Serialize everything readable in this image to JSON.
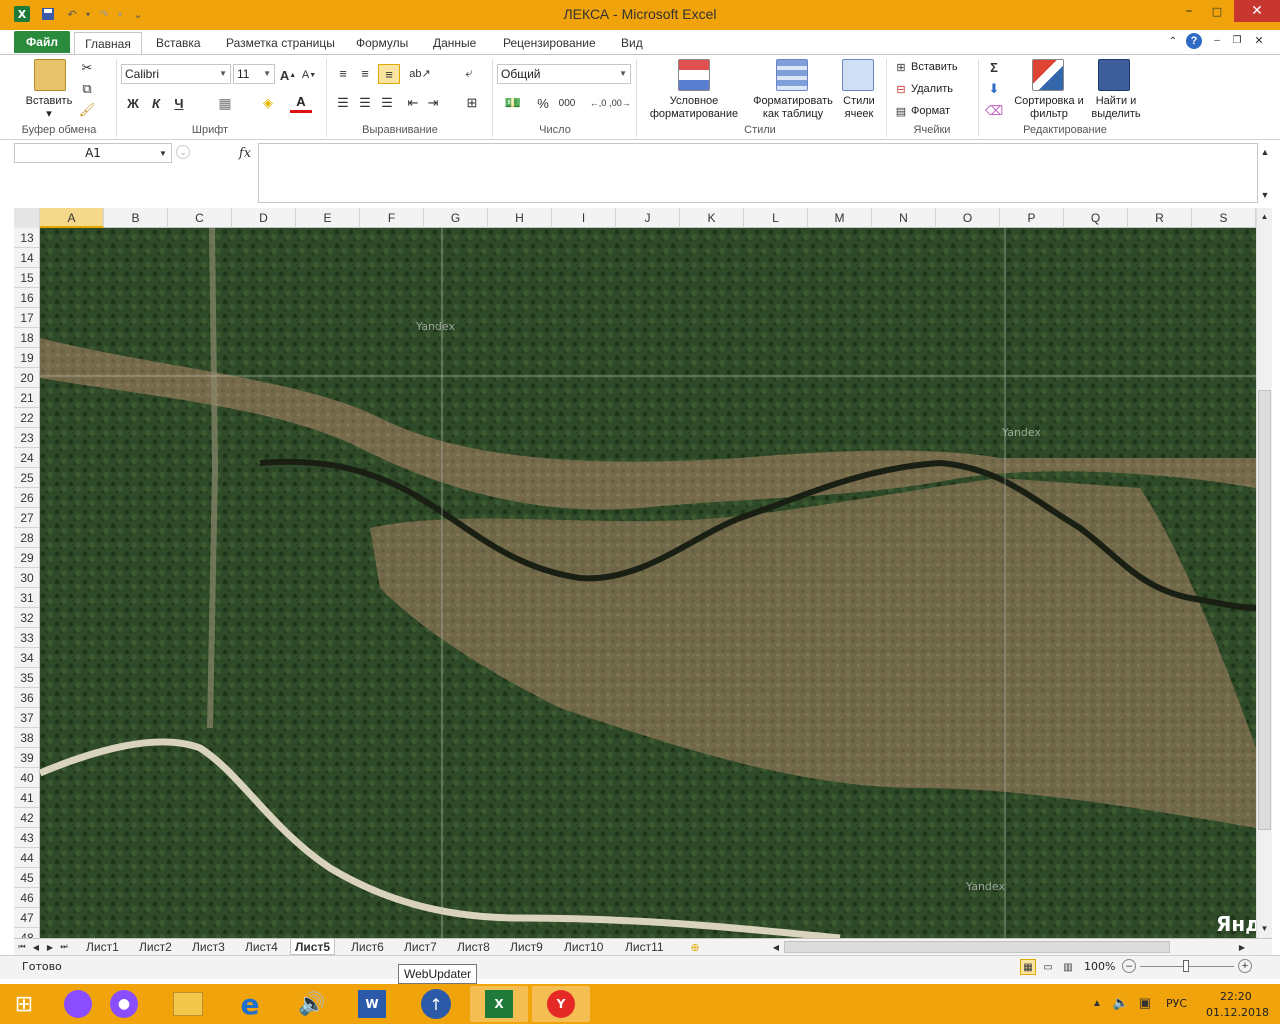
{
  "window": {
    "title": "ЛЕКСА  -  Microsoft Excel"
  },
  "ribbon_tabs": [
    "Файл",
    "Главная",
    "Вставка",
    "Разметка страницы",
    "Формулы",
    "Данные",
    "Рецензирование",
    "Вид"
  ],
  "ribbon": {
    "paste_label": "Вставить",
    "font_name": "Calibri",
    "font_size": "11",
    "bold": "Ж",
    "italic": "К",
    "underline": "Ч",
    "number_format": "Общий",
    "percent": "%",
    "thousands": "000",
    "cond_format": "Условное форматирование",
    "format_table": "Форматировать как таблицу",
    "cell_styles": "Стили ячеек",
    "insert": "Вставить",
    "delete": "Удалить",
    "format": "Формат",
    "sort_filter": "Сортировка и фильтр",
    "find_select": "Найти и выделить",
    "groups": {
      "clipboard": "Буфер обмена",
      "font": "Шрифт",
      "alignment": "Выравнивание",
      "number": "Число",
      "styles": "Стили",
      "cells": "Ячейки",
      "editing": "Редактирование"
    }
  },
  "formula_bar": {
    "name_box": "A1",
    "fx": "fx",
    "content": ""
  },
  "columns": [
    "A",
    "B",
    "C",
    "D",
    "E",
    "F",
    "G",
    "H",
    "I",
    "J",
    "K",
    "L",
    "M",
    "N",
    "O",
    "P",
    "Q",
    "R",
    "S"
  ],
  "rows": [
    "13",
    "14",
    "15",
    "16",
    "17",
    "18",
    "19",
    "20",
    "21",
    "22",
    "23",
    "24",
    "25",
    "26",
    "27",
    "28",
    "29",
    "30",
    "31",
    "32",
    "33",
    "34",
    "35",
    "36",
    "37",
    "38",
    "39",
    "40",
    "41",
    "42",
    "43",
    "44",
    "45",
    "46",
    "47",
    "48"
  ],
  "map": {
    "watermarks": [
      "Yandex",
      "Yandex",
      "Yandex"
    ],
    "corner_text": "Янд"
  },
  "sheets": [
    "Лист1",
    "Лист2",
    "Лист3",
    "Лист4",
    "Лист5",
    "Лист6",
    "Лист7",
    "Лист8",
    "Лист9",
    "Лист10",
    "Лист11"
  ],
  "active_sheet": "Лист5",
  "status": {
    "ready": "Готово",
    "zoom": "100%",
    "tooltip": "WebUpdater"
  },
  "taskbar": {
    "lang": "РУС",
    "time": "22:20",
    "date": "01.12.2018"
  },
  "colors": {
    "title_bar": "#f0a30a",
    "file_tab": "#2a8b3d",
    "close_button": "#c7372f",
    "forest": "#2e4526",
    "field": "#8a7a55"
  }
}
